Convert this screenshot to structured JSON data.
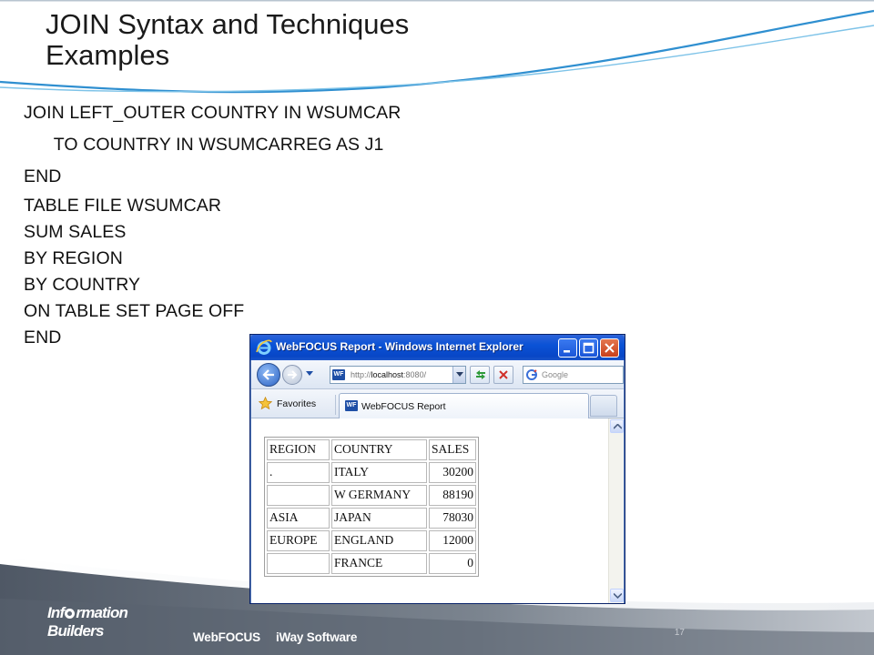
{
  "slide": {
    "title_line1": "JOIN Syntax and Techniques",
    "title_line2": "Examples",
    "code_lines": [
      "JOIN LEFT_OUTER COUNTRY IN WSUMCAR",
      "      TO COUNTRY IN WSUMCARREG AS J1",
      "END",
      "TABLE FILE WSUMCAR",
      "SUM SALES",
      "BY REGION",
      "BY COUNTRY",
      "ON TABLE SET PAGE OFF",
      "END"
    ],
    "page_number": "17"
  },
  "footer": {
    "logo_line1_a": "Inf",
    "logo_line1_b": "rmation",
    "logo_line2": "Builders",
    "link1": "WebFOCUS",
    "link2": "iWay Software"
  },
  "browser": {
    "window_title": "WebFOCUS Report - Windows Internet Explorer",
    "address_prefix": "http://",
    "address_host": "localhost",
    "address_suffix": ":8080/",
    "search_placeholder": "Google",
    "favorites_label": "Favorites",
    "tab_label": "WebFOCUS Report",
    "favicon_text": "WF"
  },
  "report": {
    "headers": [
      "REGION",
      "COUNTRY",
      "SALES"
    ],
    "rows": [
      [
        ".",
        "ITALY",
        "30200"
      ],
      [
        "",
        "W GERMANY",
        "88190"
      ],
      [
        "ASIA",
        "JAPAN",
        "78030"
      ],
      [
        "EUROPE",
        "ENGLAND",
        "12000"
      ],
      [
        "",
        "FRANCE",
        "0"
      ]
    ]
  },
  "colors": {
    "titlebar": "#0a52d6",
    "footer_band": "#5a6472"
  }
}
